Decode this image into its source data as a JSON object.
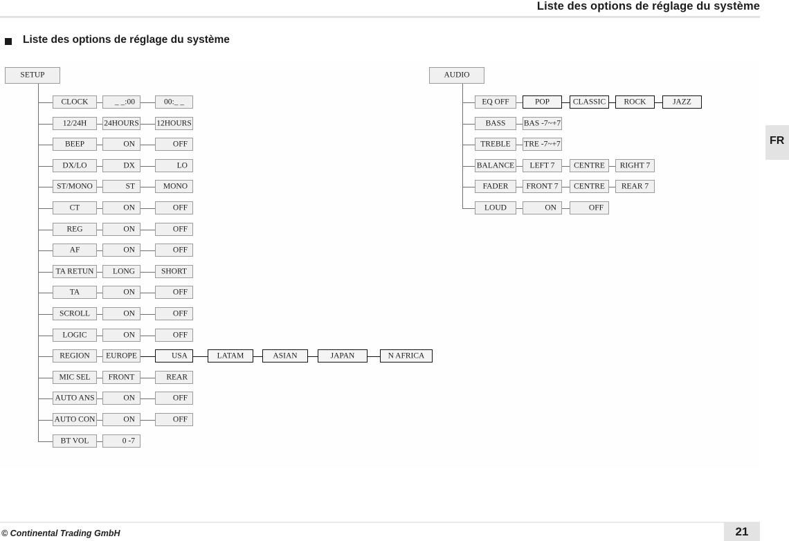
{
  "header": {
    "title": "Liste des options de réglage du système"
  },
  "section": {
    "marker_icon": "square-bullet-icon",
    "title": "Liste des options de réglage du système"
  },
  "language_tab": {
    "label": "FR"
  },
  "footer": {
    "copyright": "© Continental Trading GmbH",
    "page_number": "21"
  },
  "colors": {
    "node_fill": "#f0f0f0",
    "node_border": "#9a9a9a",
    "node_border_highlight": "#111111",
    "connector": "#6f6f6f",
    "accent_band": "#e3e3e3"
  },
  "diagram": {
    "type": "menu-tree",
    "trees": [
      {
        "id": "setup",
        "root": {
          "label": "SETUP",
          "highlight": false
        },
        "rows": [
          {
            "label": "CLOCK",
            "options": [
              {
                "label": "_ _:00",
                "highlight": false
              },
              {
                "label": "00:_ _",
                "highlight": false
              }
            ]
          },
          {
            "label": "12/24H",
            "options": [
              {
                "label": "24HOURS",
                "highlight": false
              },
              {
                "label": "12HOURS",
                "highlight": false
              }
            ]
          },
          {
            "label": "BEEP",
            "options": [
              {
                "label": "ON",
                "highlight": false
              },
              {
                "label": "OFF",
                "highlight": false
              }
            ]
          },
          {
            "label": "DX/LO",
            "options": [
              {
                "label": "DX",
                "highlight": false
              },
              {
                "label": "LO",
                "highlight": false
              }
            ]
          },
          {
            "label": "ST/MONO",
            "options": [
              {
                "label": "ST",
                "highlight": false
              },
              {
                "label": "MONO",
                "highlight": false
              }
            ]
          },
          {
            "label": "CT",
            "options": [
              {
                "label": "ON",
                "highlight": false
              },
              {
                "label": "OFF",
                "highlight": false
              }
            ]
          },
          {
            "label": "REG",
            "options": [
              {
                "label": "ON",
                "highlight": false
              },
              {
                "label": "OFF",
                "highlight": false
              }
            ]
          },
          {
            "label": "AF",
            "options": [
              {
                "label": "ON",
                "highlight": false
              },
              {
                "label": "OFF",
                "highlight": false
              }
            ]
          },
          {
            "label": "TA RETUN",
            "options": [
              {
                "label": "LONG",
                "highlight": false
              },
              {
                "label": "SHORT",
                "highlight": false
              }
            ]
          },
          {
            "label": "TA",
            "options": [
              {
                "label": "ON",
                "highlight": false
              },
              {
                "label": "OFF",
                "highlight": false
              }
            ]
          },
          {
            "label": "SCROLL",
            "options": [
              {
                "label": "ON",
                "highlight": false
              },
              {
                "label": "OFF",
                "highlight": false
              }
            ]
          },
          {
            "label": "LOGIC",
            "options": [
              {
                "label": "ON",
                "highlight": false
              },
              {
                "label": "OFF",
                "highlight": false
              }
            ]
          },
          {
            "label": "REGION",
            "options": [
              {
                "label": "EUROPE",
                "highlight": false
              },
              {
                "label": "USA",
                "highlight": true
              },
              {
                "label": "LATAM",
                "highlight": true
              },
              {
                "label": "ASIAN",
                "highlight": true
              },
              {
                "label": "JAPAN",
                "highlight": true
              },
              {
                "label": "N AFRICA",
                "highlight": true
              }
            ]
          },
          {
            "label": "MIC SEL",
            "options": [
              {
                "label": "FRONT",
                "highlight": false
              },
              {
                "label": "REAR",
                "highlight": false
              }
            ]
          },
          {
            "label": "AUTO ANS",
            "options": [
              {
                "label": "ON",
                "highlight": false
              },
              {
                "label": "OFF",
                "highlight": false
              }
            ]
          },
          {
            "label": "AUTO CON",
            "options": [
              {
                "label": "ON",
                "highlight": false
              },
              {
                "label": "OFF",
                "highlight": false
              }
            ]
          },
          {
            "label": "BT VOL",
            "options": [
              {
                "label": "0 -7",
                "highlight": false
              }
            ]
          }
        ]
      },
      {
        "id": "audio",
        "root": {
          "label": "AUDIO",
          "highlight": false
        },
        "rows": [
          {
            "label": "EQ OFF",
            "options": [
              {
                "label": "POP",
                "highlight": true
              },
              {
                "label": "CLASSIC",
                "highlight": true
              },
              {
                "label": "ROCK",
                "highlight": true
              },
              {
                "label": "JAZZ",
                "highlight": true
              }
            ]
          },
          {
            "label": "BASS",
            "options": [
              {
                "label": "BAS -7~+7",
                "highlight": false
              }
            ]
          },
          {
            "label": "TREBLE",
            "options": [
              {
                "label": "TRE -7~+7",
                "highlight": false
              }
            ]
          },
          {
            "label": "BALANCE",
            "options": [
              {
                "label": "LEFT 7",
                "highlight": false
              },
              {
                "label": "CENTRE",
                "highlight": false
              },
              {
                "label": "RIGHT 7",
                "highlight": false
              }
            ]
          },
          {
            "label": "FADER",
            "options": [
              {
                "label": "FRONT 7",
                "highlight": false
              },
              {
                "label": "CENTRE",
                "highlight": false
              },
              {
                "label": "REAR 7",
                "highlight": false
              }
            ]
          },
          {
            "label": "LOUD",
            "options": [
              {
                "label": "ON",
                "highlight": false
              },
              {
                "label": "OFF",
                "highlight": false
              }
            ]
          }
        ]
      }
    ]
  }
}
